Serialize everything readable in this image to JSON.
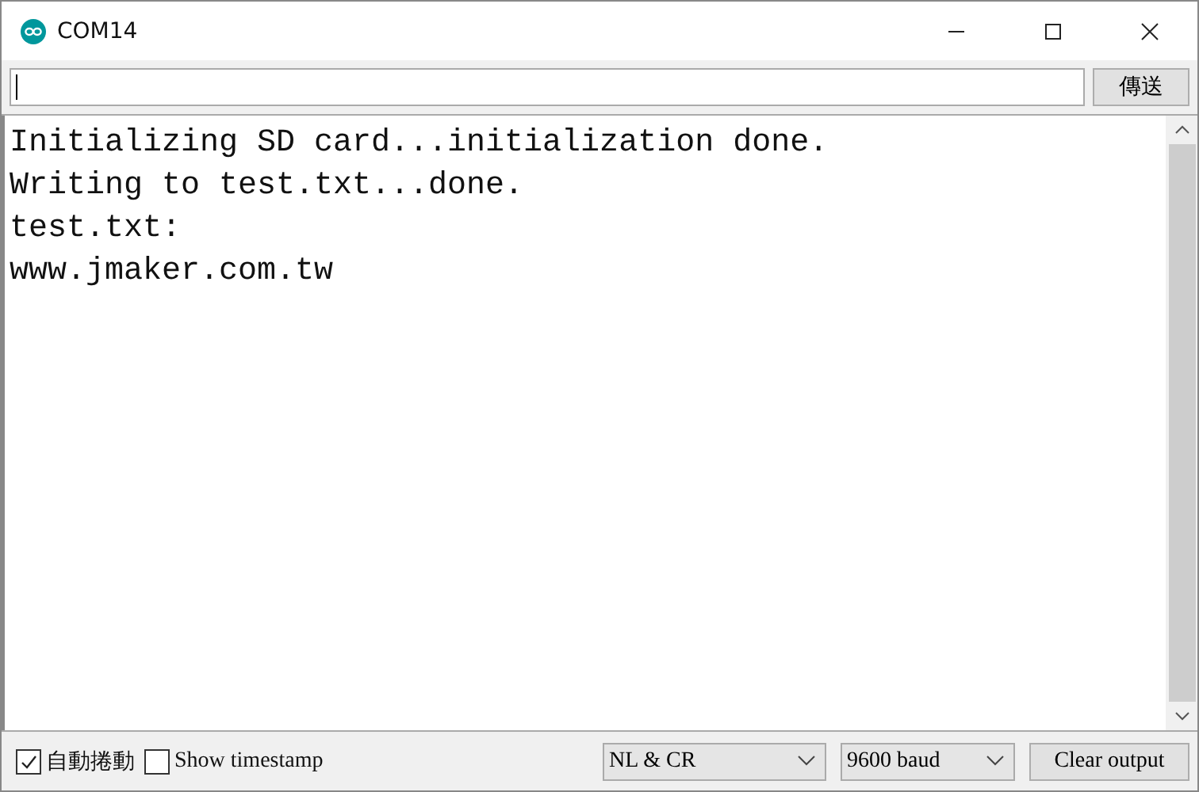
{
  "window": {
    "title": "COM14"
  },
  "send_button": "傳送",
  "output": {
    "lines": [
      "Initializing SD card...initialization done.",
      "Writing to test.txt...done.",
      "test.txt:",
      "www.jmaker.com.tw"
    ]
  },
  "options": [
    {
      "label": "自動捲動",
      "checked": true
    },
    {
      "label": "Show timestamp",
      "checked": false
    }
  ],
  "line_ending": {
    "value": "NL & CR"
  },
  "baud": {
    "value": "9600 baud"
  },
  "clear_button": "Clear output"
}
